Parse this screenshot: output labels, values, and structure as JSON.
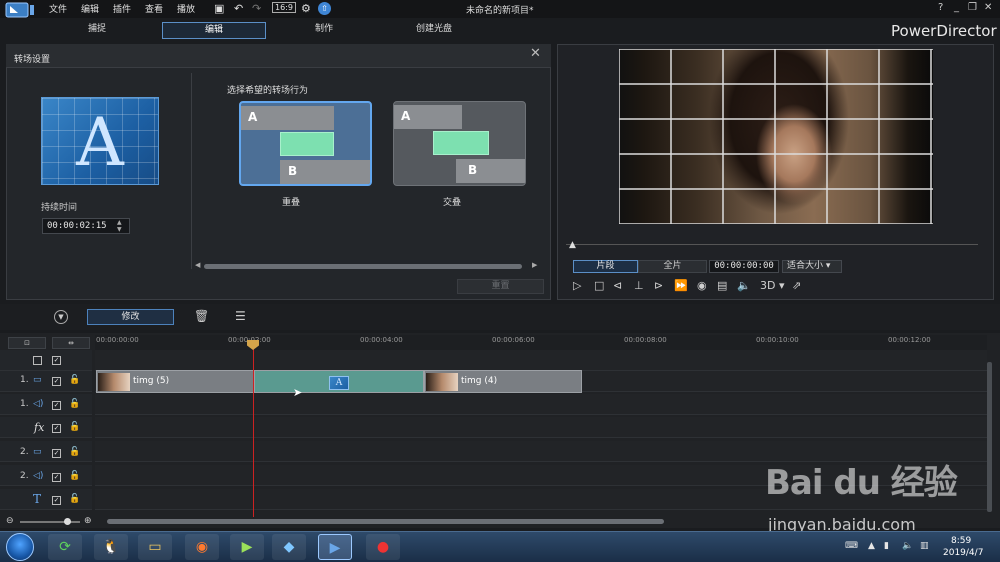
{
  "app": {
    "title": "未命名的新项目*",
    "brand": "PowerDirector",
    "menu": [
      "文件",
      "编辑",
      "插件",
      "查看",
      "播放"
    ],
    "mode_tabs": [
      "捕捉",
      "编辑",
      "制作",
      "创建光盘"
    ],
    "active_mode": "编辑",
    "window_controls": [
      "?",
      "_",
      "❐",
      "✕"
    ]
  },
  "transition_panel": {
    "title": "转场设置",
    "duration_label": "持续时间",
    "duration_value": "00:00:02:15",
    "behavior_label": "选择希望的转场行为",
    "behaviors": [
      {
        "name": "重叠",
        "a": "A",
        "b": "B",
        "selected": true
      },
      {
        "name": "交叠",
        "a": "A",
        "b": "B",
        "selected": false
      }
    ],
    "thumb_letter": "A",
    "reset_label": "重置"
  },
  "preview": {
    "clip_tab": "片段",
    "movie_tab": "全片",
    "timecode": "00:00:00:00",
    "fit_label": "适合大小",
    "three_d": "3D"
  },
  "toolbar": {
    "modify_label": "修改"
  },
  "timeline": {
    "ticks": [
      "00:00:00:00",
      "00:00:02:00",
      "00:00:04:00",
      "00:00:06:00",
      "00:00:08:00",
      "00:00:10:00",
      "00:00:12:00"
    ],
    "tracks": [
      {
        "num": "",
        "icon": ""
      },
      {
        "num": "1.",
        "icon": "video-track"
      },
      {
        "num": "1.",
        "icon": "audio-track"
      },
      {
        "num": "",
        "icon": "fx-track"
      },
      {
        "num": "2.",
        "icon": "video-track"
      },
      {
        "num": "2.",
        "icon": "audio-track"
      },
      {
        "num": "",
        "icon": "title-track"
      }
    ],
    "clips": [
      {
        "name": "timg (5)"
      },
      {
        "name": "timg (4)"
      }
    ]
  },
  "taskbar": {
    "time": "8:59",
    "date": "2019/4/7"
  },
  "watermark": {
    "logo": "Bai du 经验",
    "url": "jingyan.baidu.com"
  },
  "colors": {
    "accent": "#5b8fc7",
    "transition_green": "#7de0b0",
    "playhead": "#cc2222"
  }
}
